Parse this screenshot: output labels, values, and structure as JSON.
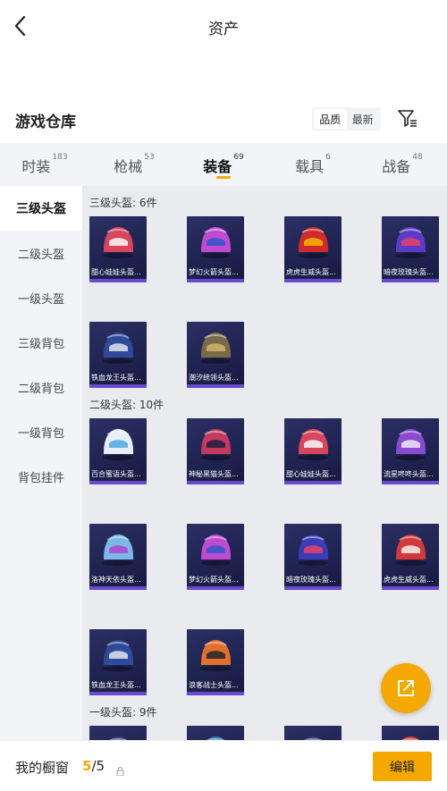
{
  "header": {
    "title": "资产"
  },
  "warehouse": {
    "title": "游戏仓库",
    "sort_options": [
      "品质",
      "最新"
    ],
    "active_sort": 0
  },
  "tabs": [
    {
      "label": "时装",
      "count": "183"
    },
    {
      "label": "枪械",
      "count": "53"
    },
    {
      "label": "装备",
      "count": "69",
      "active": true
    },
    {
      "label": "载具",
      "count": "6"
    },
    {
      "label": "战备",
      "count": "48"
    }
  ],
  "sidebar": {
    "items": [
      {
        "label": "三级头盔",
        "active": true
      },
      {
        "label": "二级头盔"
      },
      {
        "label": "一级头盔"
      },
      {
        "label": "三级背包"
      },
      {
        "label": "二级背包"
      },
      {
        "label": "一级背包"
      },
      {
        "label": "背包挂件"
      }
    ]
  },
  "sections": [
    {
      "label": "三级头盔: 6件",
      "items": [
        {
          "name": "甜心娃娃头盔...",
          "color": "#d9455a",
          "accent": "#f3f0f0"
        },
        {
          "name": "梦幻火箭头盔...",
          "color": "#c04bd0",
          "accent": "#3a55c9"
        },
        {
          "name": "虎虎生威头盔...",
          "color": "#d02a2a",
          "accent": "#f0b000"
        },
        {
          "name": "暗夜玫瑰头盔...",
          "color": "#5a3cc8",
          "accent": "#e0406a"
        },
        {
          "name": "铁血龙王头盔...",
          "color": "#2f4a9a",
          "accent": "#d8dde8"
        },
        {
          "name": "潮汐统领头盔...",
          "color": "#7a6a4a",
          "accent": "#c9b06a"
        }
      ]
    },
    {
      "label": "二级头盔: 10件",
      "items": [
        {
          "name": "百合蜜语头盔...",
          "color": "#e6eef7",
          "accent": "#5aaae0"
        },
        {
          "name": "神秘黑猫头盔...",
          "color": "#c23a5e",
          "accent": "#2a1f3f"
        },
        {
          "name": "甜心娃娃头盔...",
          "color": "#d9455a",
          "accent": "#f3f0f0"
        },
        {
          "name": "流星咚咚头盔...",
          "color": "#8a4ad0",
          "accent": "#e8e0f8"
        },
        {
          "name": "洛神天依头盔...",
          "color": "#7ab8e8",
          "accent": "#b04ad0"
        },
        {
          "name": "梦幻火箭头盔...",
          "color": "#c04bd0",
          "accent": "#3a55c9"
        },
        {
          "name": "暗夜玫瑰头盔...",
          "color": "#3a3cb8",
          "accent": "#e0406a"
        },
        {
          "name": "虎虎生威头盔...",
          "color": "#d03a3a",
          "accent": "#f3e8e0"
        },
        {
          "name": "铁血龙王头盔...",
          "color": "#2f4a9a",
          "accent": "#d8dde8"
        },
        {
          "name": "浪客战士头盔...",
          "color": "#e0702a",
          "accent": "#2a2a2a"
        }
      ]
    },
    {
      "label": "一级头盔: 9件",
      "items": [
        {
          "name": "",
          "color": "#3a3f7a",
          "accent": "#ffffff"
        },
        {
          "name": "",
          "color": "#3a7ab8",
          "accent": "#ffffff"
        },
        {
          "name": "",
          "color": "#3a3f7a",
          "accent": "#ffffff"
        },
        {
          "name": "",
          "color": "#d03a3a",
          "accent": "#ffffff"
        }
      ]
    }
  ],
  "bottom": {
    "label": "我的橱窗",
    "count_current": "5",
    "count_sep": "/5",
    "edit_label": "编辑"
  },
  "colors": {
    "accent": "#f5a800",
    "card_bg": "#22265a",
    "card_strip": "#6a4ad0"
  }
}
